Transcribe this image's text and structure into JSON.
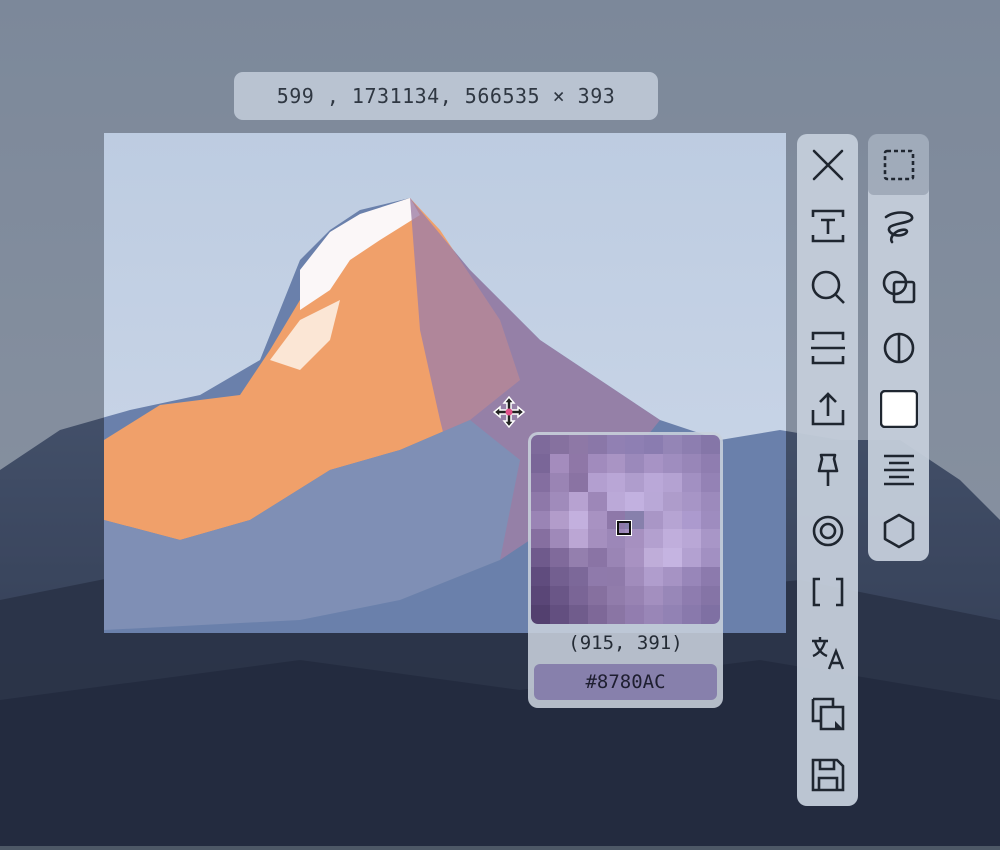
{
  "selection_info": {
    "start": "599 , 173",
    "end": "1134, 566",
    "size": "535 × 393"
  },
  "magnifier": {
    "position": "(915, 391)",
    "hex": "#8780AC",
    "pixels": [
      [
        "#7e6a9b",
        "#86719f",
        "#8e78a6",
        "#8a77a8",
        "#9180b3",
        "#8e7fb3",
        "#8a7cb0",
        "#9485b6",
        "#8d7eb0",
        "#8576a8"
      ],
      [
        "#7a6698",
        "#a48cbd",
        "#8f77a7",
        "#a18bbd",
        "#a994c4",
        "#9b89bb",
        "#a793c5",
        "#9f8dbf",
        "#9886b8",
        "#8f7db0"
      ],
      [
        "#846ea0",
        "#9a84b4",
        "#8a73a3",
        "#b39fd0",
        "#b9a6d6",
        "#af9dcd",
        "#baa8d8",
        "#b4a2d2",
        "#a290c2",
        "#9482b5"
      ],
      [
        "#8e78a9",
        "#a08bbb",
        "#b7a2d1",
        "#9d87b8",
        "#bba9d8",
        "#c2b1e0",
        "#b9a8d7",
        "#ae9ccb",
        "#a795c6",
        "#9c8abc"
      ],
      [
        "#9a84b5",
        "#b29cca",
        "#c3b0de",
        "#a892c2",
        "#8e78a9",
        "#8780AC",
        "#a996c6",
        "#b6a4d3",
        "#ac9ace",
        "#9e8cbf"
      ],
      [
        "#866fa0",
        "#9f89b9",
        "#bba6d4",
        "#a58fbf",
        "#9c87b8",
        "#a690c0",
        "#b3a0cf",
        "#c0aedc",
        "#b9a7d6",
        "#a896c7"
      ],
      [
        "#6f5a8c",
        "#806a9b",
        "#947fae",
        "#8a74a5",
        "#9a85b5",
        "#a892c2",
        "#bfadd9",
        "#c5b4e1",
        "#b3a1d1",
        "#a290c2"
      ],
      [
        "#604c7e",
        "#735f90",
        "#7c6899",
        "#8f7aab",
        "#8f7aaa",
        "#a18cbc",
        "#b09dcd",
        "#a693c4",
        "#9886b9",
        "#8c7aad"
      ],
      [
        "#5a4677",
        "#6a5687",
        "#7a6596",
        "#86709f",
        "#917cab",
        "#9883b3",
        "#a38fbf",
        "#9887b8",
        "#8e7caf",
        "#8574a6"
      ],
      [
        "#53406f",
        "#634f80",
        "#705c8c",
        "#7e6898",
        "#8a75a4",
        "#927daf",
        "#9986b7",
        "#9282b4",
        "#8979ac",
        "#7f70a3"
      ]
    ]
  },
  "main_toolbar": [
    {
      "name": "close-icon"
    },
    {
      "name": "text-icon"
    },
    {
      "name": "search-icon"
    },
    {
      "name": "scroll-capture-icon"
    },
    {
      "name": "upload-icon"
    },
    {
      "name": "pin-icon"
    },
    {
      "name": "ocr-icon"
    },
    {
      "name": "crop-bracket-icon"
    },
    {
      "name": "translate-icon"
    },
    {
      "name": "copy-icon"
    },
    {
      "name": "save-icon"
    }
  ],
  "shape_toolbar": [
    {
      "name": "rectangle-select-icon",
      "active": true
    },
    {
      "name": "lasso-icon"
    },
    {
      "name": "shapes-icon"
    },
    {
      "name": "contrast-icon"
    },
    {
      "name": "white-fill-icon"
    },
    {
      "name": "align-center-icon"
    },
    {
      "name": "hexagon-icon"
    }
  ],
  "colors": {
    "sky": "#c9d6e8",
    "accent_swatch": "#8780AC"
  }
}
